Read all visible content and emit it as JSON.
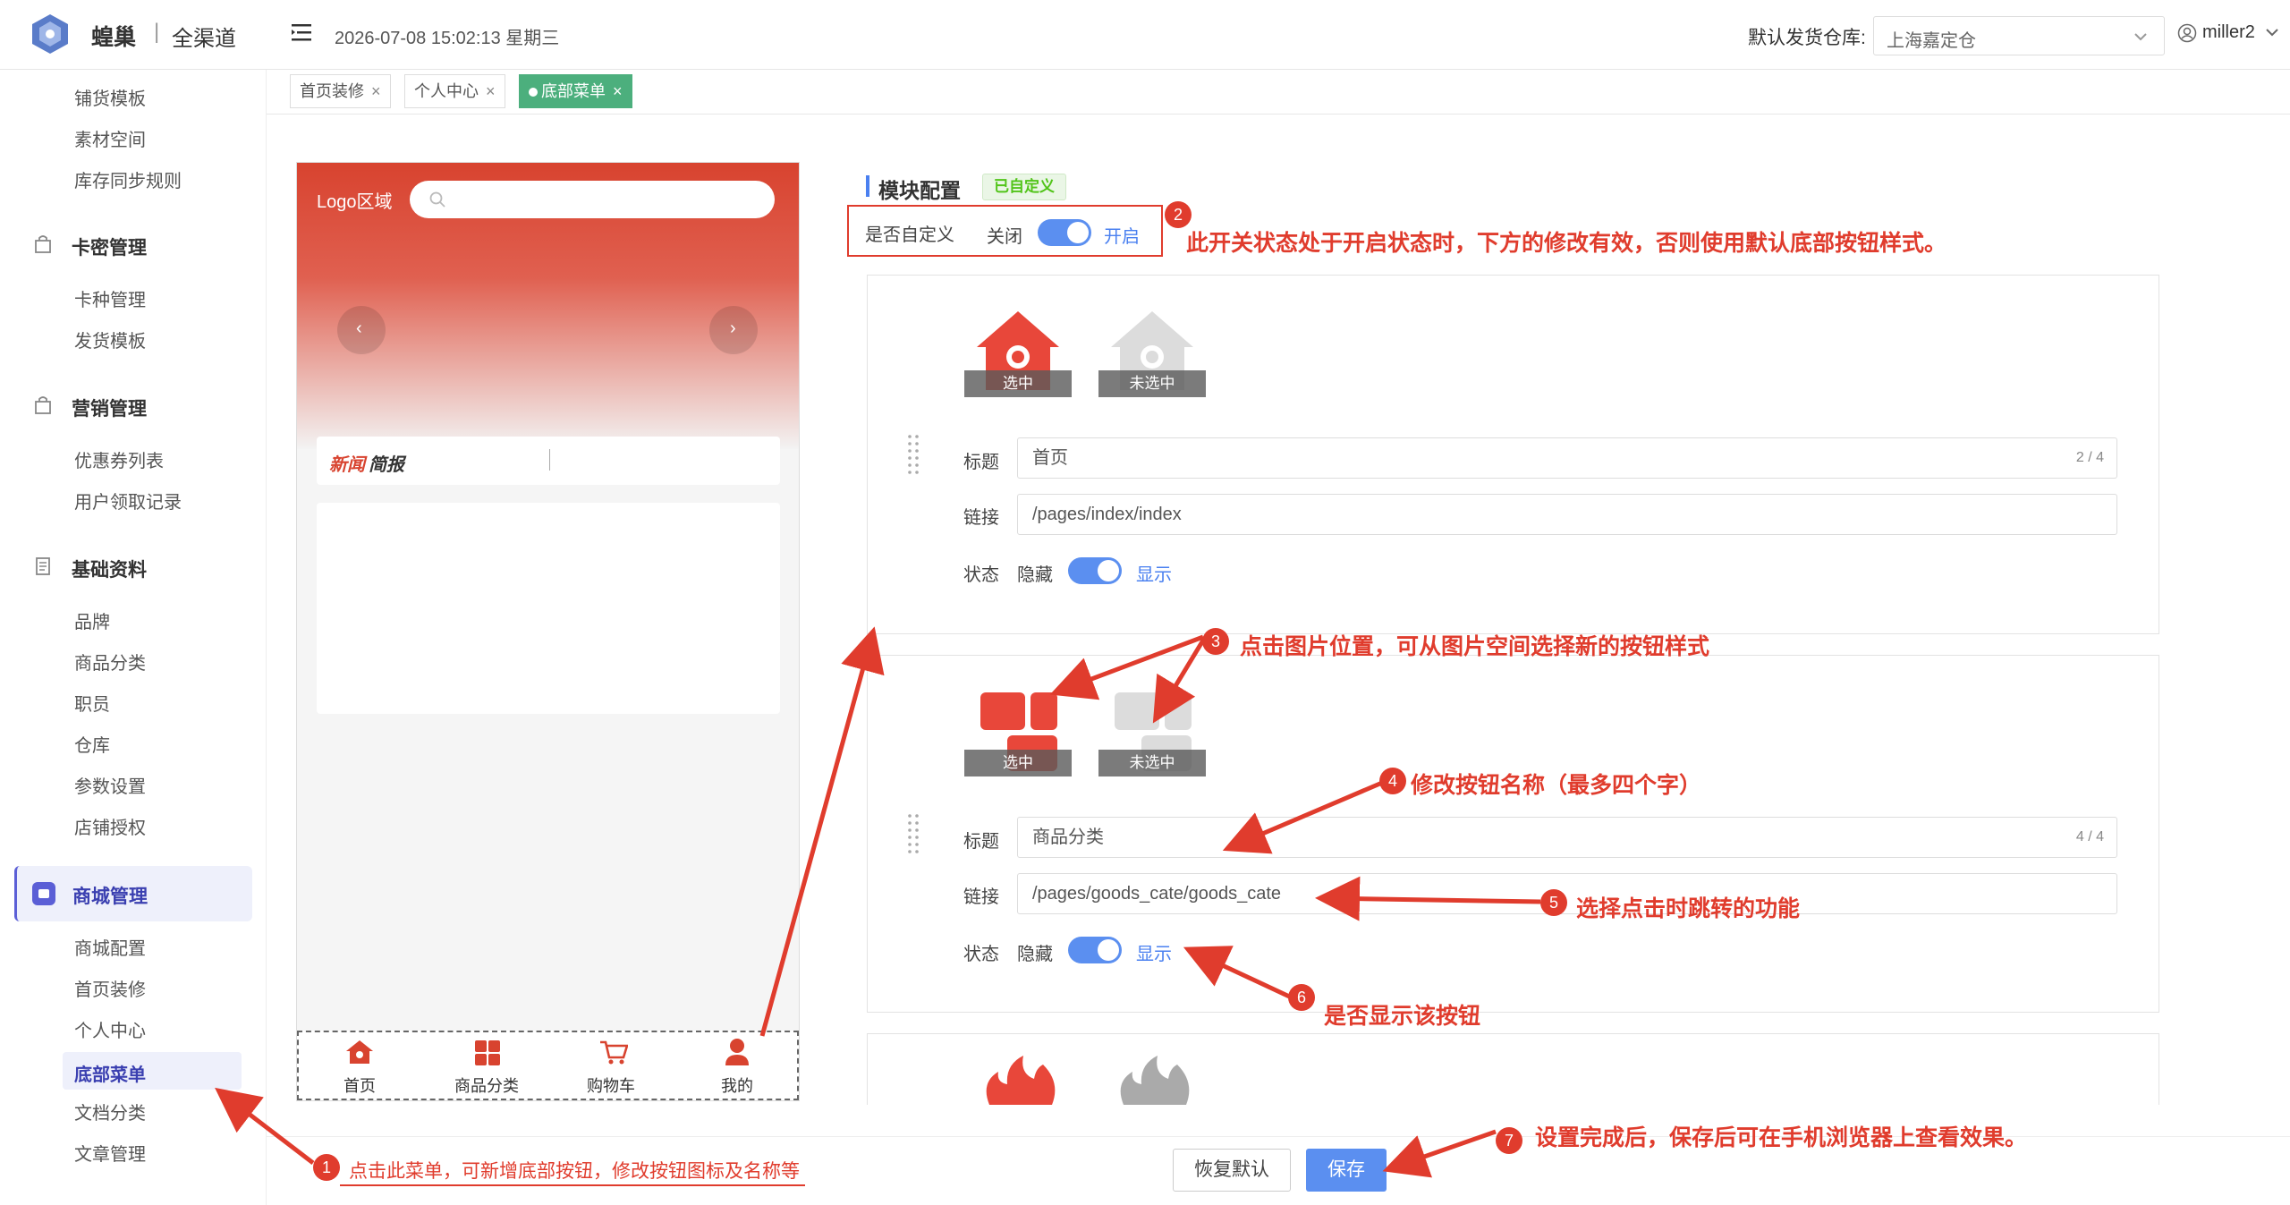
{
  "header": {
    "brand": "蝗巢",
    "sub": "全渠道",
    "datetime": "2026-07-08 15:02:13 星期三",
    "warehouse_label": "默认发货仓库:",
    "warehouse_value": "上海嘉定仓",
    "user": "miller2"
  },
  "sidebar": {
    "items_top": [
      "铺货模板",
      "素材空间",
      "库存同步规则"
    ],
    "groups": [
      {
        "label": "卡密管理",
        "items": [
          "卡种管理",
          "发货模板"
        ]
      },
      {
        "label": "营销管理",
        "items": [
          "优惠券列表",
          "用户领取记录"
        ]
      },
      {
        "label": "基础资料",
        "items": [
          "品牌",
          "商品分类",
          "职员",
          "仓库",
          "参数设置",
          "店铺授权"
        ]
      },
      {
        "label": "商城管理",
        "items": [
          "商城配置",
          "首页装修",
          "个人中心",
          "底部菜单",
          "文档分类",
          "文章管理"
        ]
      }
    ]
  },
  "tabs": [
    "首页装修",
    "个人中心",
    "底部菜单"
  ],
  "tab_close": "×",
  "phone": {
    "logo_area": "Logo区域",
    "news_a": "新闻",
    "news_b": "简报",
    "nav": [
      "首页",
      "商品分类",
      "购物车",
      "我的"
    ]
  },
  "config": {
    "title": "模块配置",
    "badge": "已自定义",
    "custom_label": "是否自定义",
    "off_label": "关闭",
    "on_label": "开启",
    "items": [
      {
        "selected": "选中",
        "unselected": "未选中",
        "title_label": "标题",
        "title_value": "首页",
        "title_count": "2 / 4",
        "link_label": "链接",
        "link_value": "/pages/index/index",
        "status_label": "状态",
        "hide_label": "隐藏",
        "show_label": "显示"
      },
      {
        "selected": "选中",
        "unselected": "未选中",
        "title_label": "标题",
        "title_value": "商品分类",
        "title_count": "4 / 4",
        "link_label": "链接",
        "link_value": "/pages/goods_cate/goods_cate",
        "status_label": "状态",
        "hide_label": "隐藏",
        "show_label": "显示"
      }
    ]
  },
  "footer": {
    "reset": "恢复默认",
    "save": "保存"
  },
  "annotations": [
    {
      "n": "1",
      "text": "点击此菜单，可新增底部按钮，修改按钮图标及名称等"
    },
    {
      "n": "2",
      "text": "此开关状态处于开启状态时，下方的修改有效，否则使用默认底部按钮样式。"
    },
    {
      "n": "3",
      "text": "点击图片位置，可从图片空间选择新的按钮样式"
    },
    {
      "n": "4",
      "text": "修改按钮名称（最多四个字）"
    },
    {
      "n": "5",
      "text": "选择点击时跳转的功能"
    },
    {
      "n": "6",
      "text": "是否显示该按钮"
    },
    {
      "n": "7",
      "text": "设置完成后，保存后可在手机浏览器上查看效果。"
    }
  ],
  "colors": {
    "accent": "#4a80f0",
    "annotation": "#e03c2d",
    "tab_active": "#4caf7d",
    "brand_red": "#e8473a"
  }
}
